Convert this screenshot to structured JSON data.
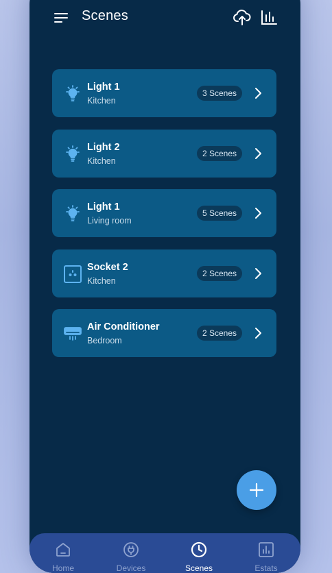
{
  "header": {
    "title": "Scenes",
    "menu_icon": "hamburger-menu-icon",
    "upload_icon": "cloud-upload-icon",
    "stats_icon": "bar-chart-icon"
  },
  "devices": [
    {
      "name": "Light 1",
      "room": "Kitchen",
      "scenes": "3 Scenes",
      "icon": "light-bulb-icon"
    },
    {
      "name": "Light 2",
      "room": "Kitchen",
      "scenes": "2 Scenes",
      "icon": "light-bulb-icon"
    },
    {
      "name": "Light 1",
      "room": "Living room",
      "scenes": "5 Scenes",
      "icon": "light-bulb-icon"
    },
    {
      "name": "Socket 2",
      "room": "Kitchen",
      "scenes": "2 Scenes",
      "icon": "socket-icon"
    },
    {
      "name": "Air Conditioner",
      "room": "Bedroom",
      "scenes": "2 Scenes",
      "icon": "air-conditioner-icon"
    }
  ],
  "fab": {
    "icon": "plus-icon"
  },
  "nav": {
    "items": [
      {
        "label": "Home",
        "icon": "home-icon"
      },
      {
        "label": "Devices",
        "icon": "plug-icon"
      },
      {
        "label": "Scenes",
        "icon": "clock-icon",
        "active": true
      },
      {
        "label": "Estats",
        "icon": "stats-icon"
      }
    ]
  },
  "colors": {
    "background": "#072a48",
    "card": "#0c5a86",
    "badge": "#0b3a5a",
    "accent": "#4a9ee6",
    "nav_bar": "#2a4b95",
    "icon_blue": "#5db3f0"
  }
}
